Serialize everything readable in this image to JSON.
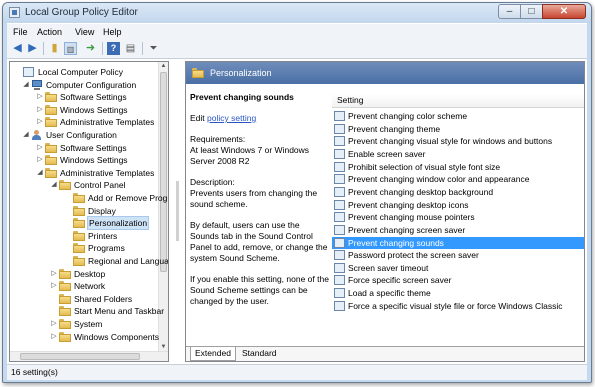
{
  "window": {
    "title": "Local Group Policy Editor",
    "controls": {
      "minimize": "–",
      "maximize": "□",
      "close": "✕"
    }
  },
  "menu": [
    "File",
    "Action",
    "View",
    "Help"
  ],
  "toolbar_icons": [
    "back-icon",
    "forward-icon",
    "up-icon",
    "show-hide-tree-icon",
    "export-icon",
    "help-icon",
    "properties-icon",
    "filter-icon"
  ],
  "tree": [
    {
      "label": "Local Computer Policy",
      "level": 0,
      "icon": "policy",
      "toggle": ""
    },
    {
      "label": "Computer Configuration",
      "level": 1,
      "icon": "computer",
      "toggle": "◢"
    },
    {
      "label": "Software Settings",
      "level": 2,
      "icon": "folder",
      "toggle": "▷"
    },
    {
      "label": "Windows Settings",
      "level": 2,
      "icon": "folder",
      "toggle": "▷"
    },
    {
      "label": "Administrative Templates",
      "level": 2,
      "icon": "folder",
      "toggle": "▷"
    },
    {
      "label": "User Configuration",
      "level": 1,
      "icon": "user",
      "toggle": "◢"
    },
    {
      "label": "Software Settings",
      "level": 2,
      "icon": "folder",
      "toggle": "▷"
    },
    {
      "label": "Windows Settings",
      "level": 2,
      "icon": "folder",
      "toggle": "▷"
    },
    {
      "label": "Administrative Templates",
      "level": 2,
      "icon": "folder",
      "toggle": "◢"
    },
    {
      "label": "Control Panel",
      "level": 3,
      "icon": "folder",
      "toggle": "◢"
    },
    {
      "label": "Add or Remove Programs",
      "level": 4,
      "icon": "folder",
      "toggle": ""
    },
    {
      "label": "Display",
      "level": 4,
      "icon": "folder",
      "toggle": ""
    },
    {
      "label": "Personalization",
      "level": 4,
      "icon": "folder",
      "toggle": "",
      "selected": true
    },
    {
      "label": "Printers",
      "level": 4,
      "icon": "folder",
      "toggle": ""
    },
    {
      "label": "Programs",
      "level": 4,
      "icon": "folder",
      "toggle": ""
    },
    {
      "label": "Regional and Language",
      "level": 4,
      "icon": "folder",
      "toggle": ""
    },
    {
      "label": "Desktop",
      "level": 3,
      "icon": "folder",
      "toggle": "▷"
    },
    {
      "label": "Network",
      "level": 3,
      "icon": "folder",
      "toggle": "▷"
    },
    {
      "label": "Shared Folders",
      "level": 3,
      "icon": "folder",
      "toggle": ""
    },
    {
      "label": "Start Menu and Taskbar",
      "level": 3,
      "icon": "folder",
      "toggle": ""
    },
    {
      "label": "System",
      "level": 3,
      "icon": "folder",
      "toggle": "▷"
    },
    {
      "label": "Windows Components",
      "level": 3,
      "icon": "folder",
      "toggle": "▷"
    }
  ],
  "details": {
    "header": "Personalization",
    "policy_title": "Prevent changing sounds",
    "edit_prefix": "Edit",
    "edit_link": "policy setting",
    "requirements_label": "Requirements:",
    "requirements_text": "At least Windows 7 or Windows Server 2008 R2",
    "description_label": "Description:",
    "description_text": "Prevents users from changing the sound scheme.",
    "para2": "By default, users can use the Sounds tab in the Sound Control Panel to add, remove, or change the system Sound Scheme.",
    "para3": "If you enable this setting, none of the Sound Scheme settings can be changed by the user."
  },
  "list": {
    "column": "Setting",
    "items": [
      "Prevent changing color scheme",
      "Prevent changing theme",
      "Prevent changing visual style for windows and buttons",
      "Enable screen saver",
      "Prohibit selection of visual style font size",
      "Prevent changing window color and appearance",
      "Prevent changing desktop background",
      "Prevent changing desktop icons",
      "Prevent changing mouse pointers",
      "Prevent changing screen saver",
      "Prevent changing sounds",
      "Password protect the screen saver",
      "Screen saver timeout",
      "Force specific screen saver",
      "Load a specific theme",
      "Force a specific visual style file or force Windows Classic"
    ],
    "selected_index": 10
  },
  "tabs": [
    "Extended",
    "Standard"
  ],
  "status": "16 setting(s)",
  "colors": {
    "selection": "#3399ff",
    "header": "#4a6fa5",
    "link": "#2a56c5"
  }
}
